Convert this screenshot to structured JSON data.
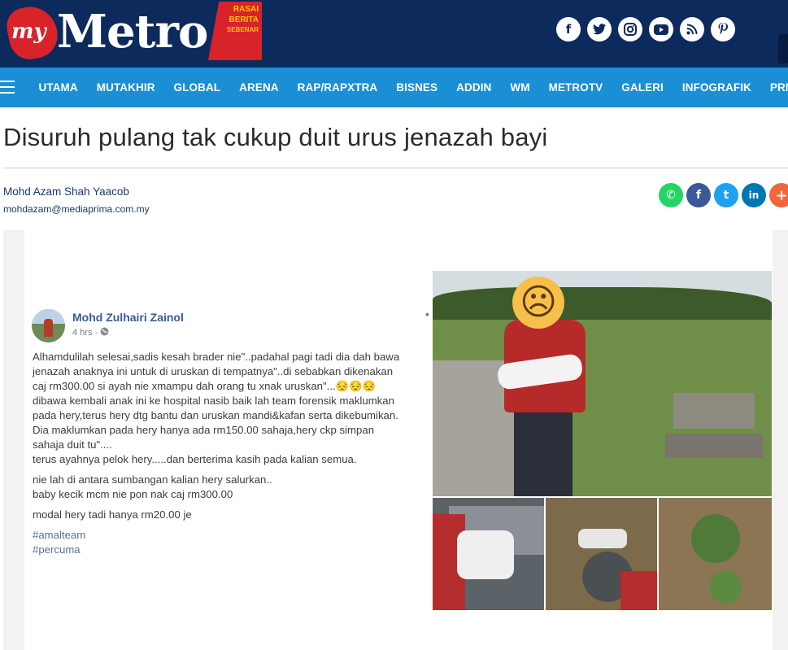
{
  "header": {
    "logo_my": "my",
    "logo_metro": "Metro",
    "logo_tag": [
      "RASAI",
      "BERITA",
      "SEBENAR"
    ],
    "social_icons": [
      "facebook-icon",
      "twitter-icon",
      "instagram-icon",
      "youtube-icon",
      "rss-icon",
      "pinterest-icon"
    ],
    "social_glyphs": [
      "f",
      "🐦",
      "◎",
      "▶",
      "◉",
      "P"
    ]
  },
  "nav": {
    "items": [
      "UTAMA",
      "MUTAKHIR",
      "GLOBAL",
      "ARENA",
      "RAP/RAPXTRA",
      "BISNES",
      "ADDIN",
      "WM",
      "METROTV",
      "GALERI",
      "INFOGRAFIK",
      "PRN"
    ]
  },
  "article": {
    "title": "Disuruh pulang tak cukup duit urus jenazah bayi",
    "author": "Mohd Azam Shah Yaacob",
    "email": "mohdazam@mediaprima.com.my"
  },
  "share": {
    "buttons": [
      {
        "name": "whatsapp-share-button",
        "glyph": "✆",
        "color": "#25d366"
      },
      {
        "name": "facebook-share-button",
        "glyph": "f",
        "color": "#3b5998"
      },
      {
        "name": "twitter-share-button",
        "glyph": "t",
        "color": "#1da1f2"
      },
      {
        "name": "linkedin-share-button",
        "glyph": "in",
        "color": "#0077b5"
      },
      {
        "name": "more-share-button",
        "glyph": "+",
        "color": "#f2663b"
      }
    ]
  },
  "facebook_post": {
    "name": "Mohd Zulhairi Zainol",
    "time": "4 hrs ·",
    "lines": [
      "Alhamdulilah selesai,sadis kesah brader nie\"..padahal pagi tadi dia dah bawa",
      "jenazah anaknya ini untuk di uruskan di tempatnya\"..di sebabkan dikenakan",
      "caj rm300.00 si ayah nie xmampu dah orang tu xnak uruskan\"...😔😔😔",
      "dibawa kembali anak ini ke hospital nasib baik lah team forensik maklumkan",
      "pada hery,terus hery dtg bantu dan uruskan mandi&kafan serta dikebumikan.",
      "Dia maklumkan pada hery hanya ada rm150.00 sahaja,hery ckp simpan",
      "sahaja duit tu\"....",
      "terus ayahnya pelok hery.....dan berterima kasih pada kalian semua."
    ],
    "lines2": [
      "nie lah di antara sumbangan kalian hery salurkan..",
      "baby kecik mcm nie pon nak caj rm300.00"
    ],
    "line3": "modal hery tadi hanya rm20.00 je",
    "hashtags": [
      "#amalteam",
      "#percuma"
    ]
  },
  "photo": {
    "emoji": "☹"
  }
}
